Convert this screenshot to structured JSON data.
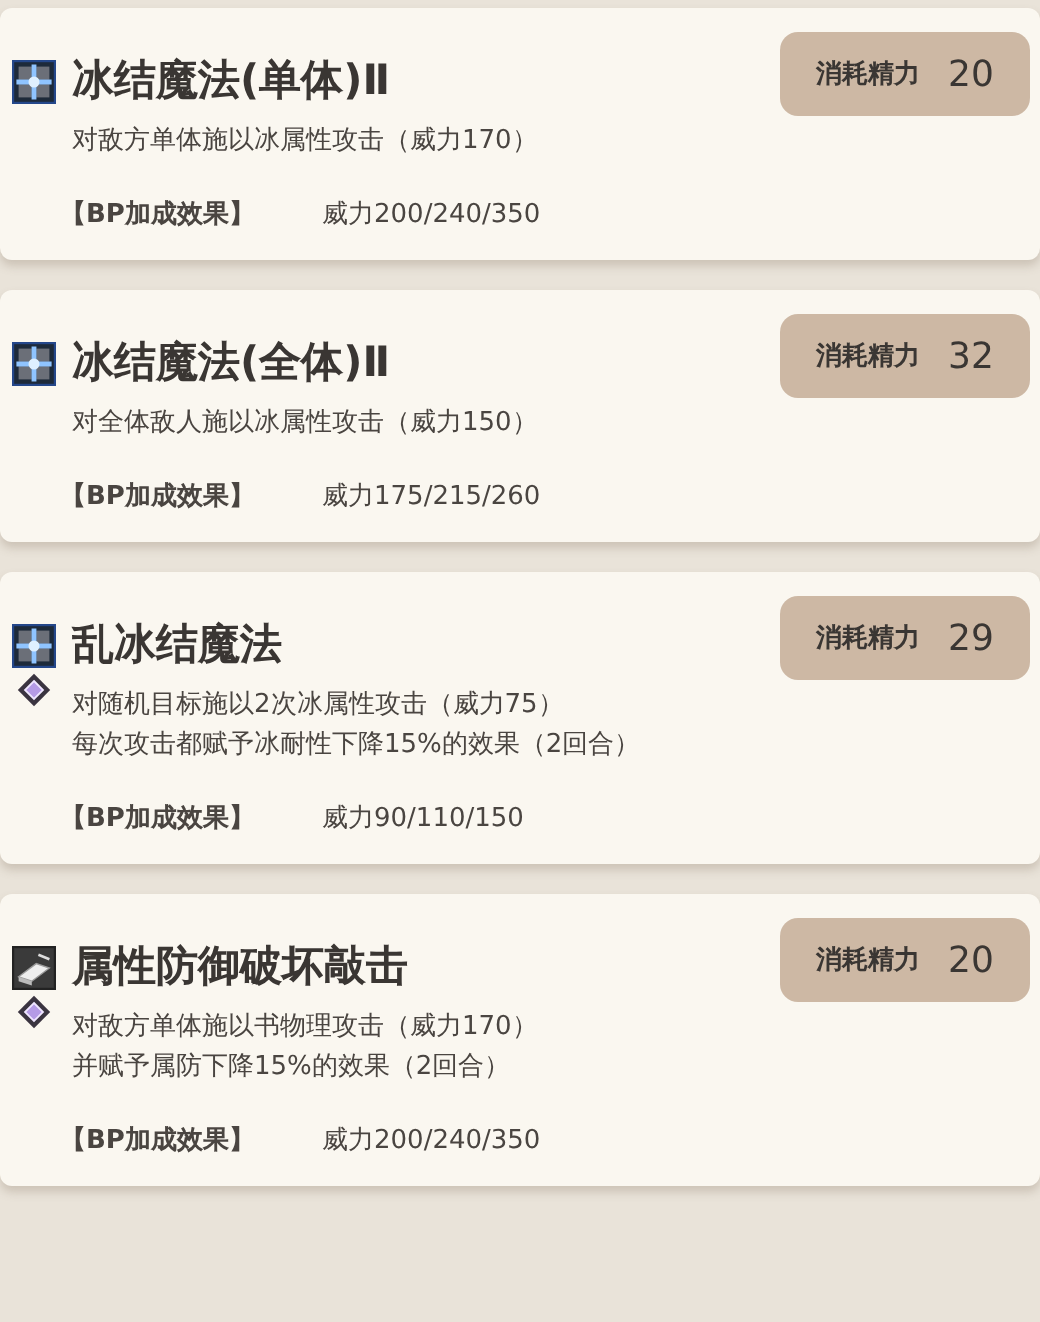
{
  "skills": [
    {
      "name": "冰结魔法(单体)Ⅱ",
      "icons": [
        {
          "kind": "ice"
        }
      ],
      "cost_label": "消耗精力",
      "cost": "20",
      "description": [
        "对敌方单体施以冰属性攻击（威力170）"
      ],
      "bp_label": "【BP加成效果】",
      "bp_value": "威力200/240/350"
    },
    {
      "name": "冰结魔法(全体)Ⅱ",
      "icons": [
        {
          "kind": "ice"
        }
      ],
      "cost_label": "消耗精力",
      "cost": "32",
      "description": [
        "对全体敌人施以冰属性攻击（威力150）"
      ],
      "bp_label": "【BP加成效果】",
      "bp_value": "威力175/215/260"
    },
    {
      "name": "乱冰结魔法",
      "icons": [
        {
          "kind": "ice"
        },
        {
          "kind": "diamond"
        }
      ],
      "cost_label": "消耗精力",
      "cost": "29",
      "description": [
        "对随机目标施以2次冰属性攻击（威力75）",
        "每次攻击都赋予冰耐性下降15%的效果（2回合）"
      ],
      "bp_label": "【BP加成效果】",
      "bp_value": "威力90/110/150"
    },
    {
      "name": "属性防御破坏敲击",
      "icons": [
        {
          "kind": "book"
        },
        {
          "kind": "diamond"
        }
      ],
      "cost_label": "消耗精力",
      "cost": "20",
      "description": [
        "对敌方单体施以书物理攻击（威力170）",
        "并赋予属防下降15%的效果（2回合）"
      ],
      "bp_label": "【BP加成效果】",
      "bp_value": "威力200/240/350"
    }
  ]
}
